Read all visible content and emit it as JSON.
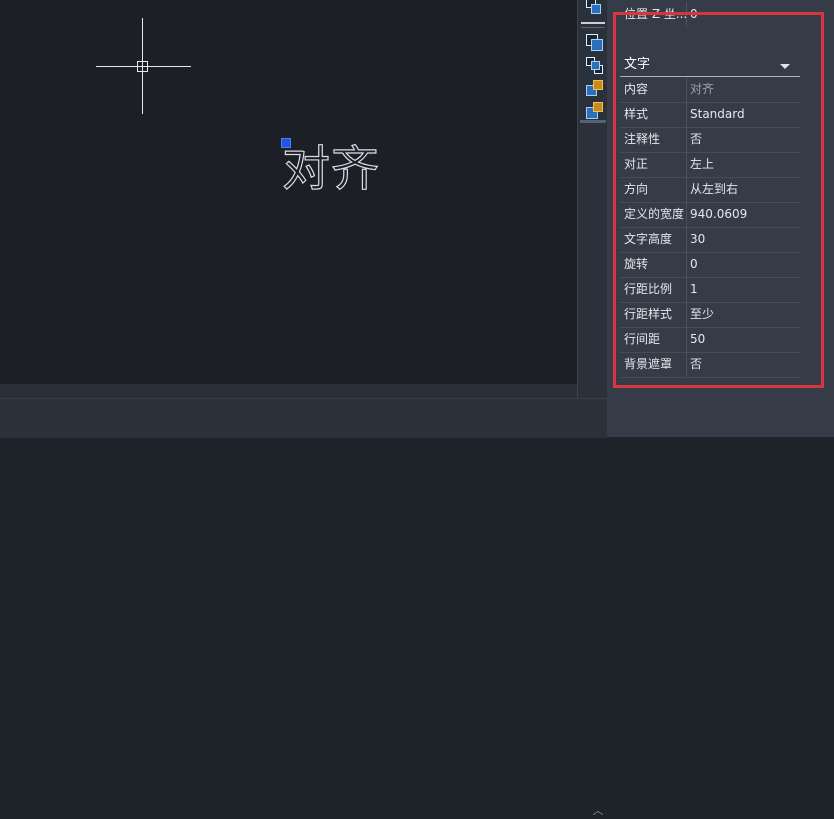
{
  "canvas": {
    "text": "对齐"
  },
  "palette": {
    "top_row": {
      "label": "位置 Z 坐...",
      "value": "0"
    },
    "section_title": "文字",
    "rows": [
      {
        "label": "内容",
        "value": "对齐",
        "gray": true
      },
      {
        "label": "样式",
        "value": "Standard"
      },
      {
        "label": "注释性",
        "value": "否"
      },
      {
        "label": "对正",
        "value": "左上"
      },
      {
        "label": "方向",
        "value": "从左到右"
      },
      {
        "label": "定义的宽度",
        "value": "940.0609"
      },
      {
        "label": "文字高度",
        "value": "30"
      },
      {
        "label": "旋转",
        "value": "0"
      },
      {
        "label": "行距比例",
        "value": "1"
      },
      {
        "label": "行距样式",
        "value": "至少"
      },
      {
        "label": "行间距",
        "value": "50"
      },
      {
        "label": "背景遮罩",
        "value": "否"
      }
    ]
  },
  "icons": {
    "toolstrip": [
      "quick-select-icon",
      "select-objects-icon",
      "toggle-pickadd-icon",
      "select-similar-icon",
      "filter-icon"
    ],
    "cmd_scroll": "chevron-up-icon"
  },
  "colors": {
    "highlight": "#d7373c",
    "grip": "#1f55e0",
    "canvas": "#1c1f26"
  }
}
